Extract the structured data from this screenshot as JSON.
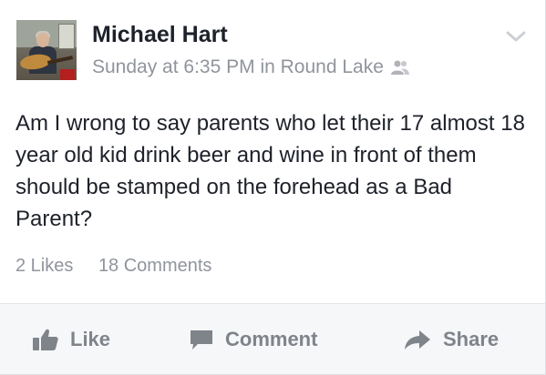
{
  "post": {
    "author": "Michael Hart",
    "meta": "Sunday at 6:35 PM in Round Lake",
    "text": "Am I wrong to say parents who let their 17 almost 18 year old kid drink beer and wine in front of them should be stamped on the forehead as a Bad Parent?",
    "likes_count": "2 Likes",
    "comments_count": "18 Comments",
    "audience_icon": "friends-icon",
    "menu_icon": "chevron-down-icon"
  },
  "actions": {
    "like": "Like",
    "comment": "Comment",
    "share": "Share"
  },
  "colors": {
    "text": "#1d2129",
    "secondary": "#90949c",
    "action": "#7f838a",
    "action_bar_bg": "#f6f7f9"
  }
}
